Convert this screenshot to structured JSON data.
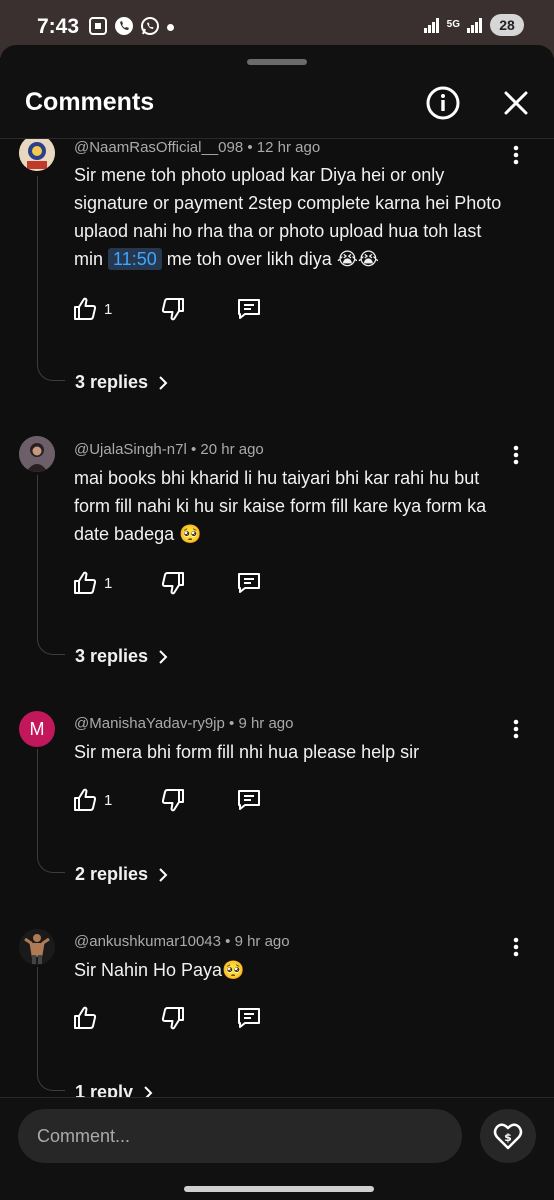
{
  "status": {
    "time": "7:43",
    "network": "5G",
    "battery": "28"
  },
  "header": {
    "title": "Comments",
    "info_icon": "info-icon",
    "close_icon": "close-icon"
  },
  "comments": [
    {
      "author": "@NaamRasOfficial__098",
      "age": "12 hr ago",
      "text_before": "Sir mene toh photo upload kar Diya hei or only signature or payment 2step complete karna hei Photo uplaod nahi ho rha tha or photo upload hua toh last min ",
      "timestamp": "11:50",
      "text_after": " me toh over likh diya 😭😭",
      "likes": "1",
      "replies": "3 replies"
    },
    {
      "author": "@UjalaSingh-n7l",
      "age": "20 hr ago",
      "text": "mai books bhi kharid li hu taiyari bhi kar rahi hu but form fill nahi ki hu sir kaise form fill kare kya form ka date badega 🥺",
      "likes": "1",
      "replies": "3 replies"
    },
    {
      "author": "@ManishaYadav-ry9jp",
      "age": "9 hr ago",
      "avatar_letter": "M",
      "text": "Sir mera bhi form fill nhi hua please help sir",
      "likes": "1",
      "replies": "2 replies"
    },
    {
      "author": "@ankushkumar10043",
      "age": "9 hr ago",
      "text": "Sir Nahin Ho Paya🥺",
      "likes": "",
      "replies": "1 reply"
    }
  ],
  "composer": {
    "placeholder": "Comment..."
  },
  "colors": {
    "accent_link": "#3ea6ff",
    "avatar_m": "#c2185b"
  }
}
